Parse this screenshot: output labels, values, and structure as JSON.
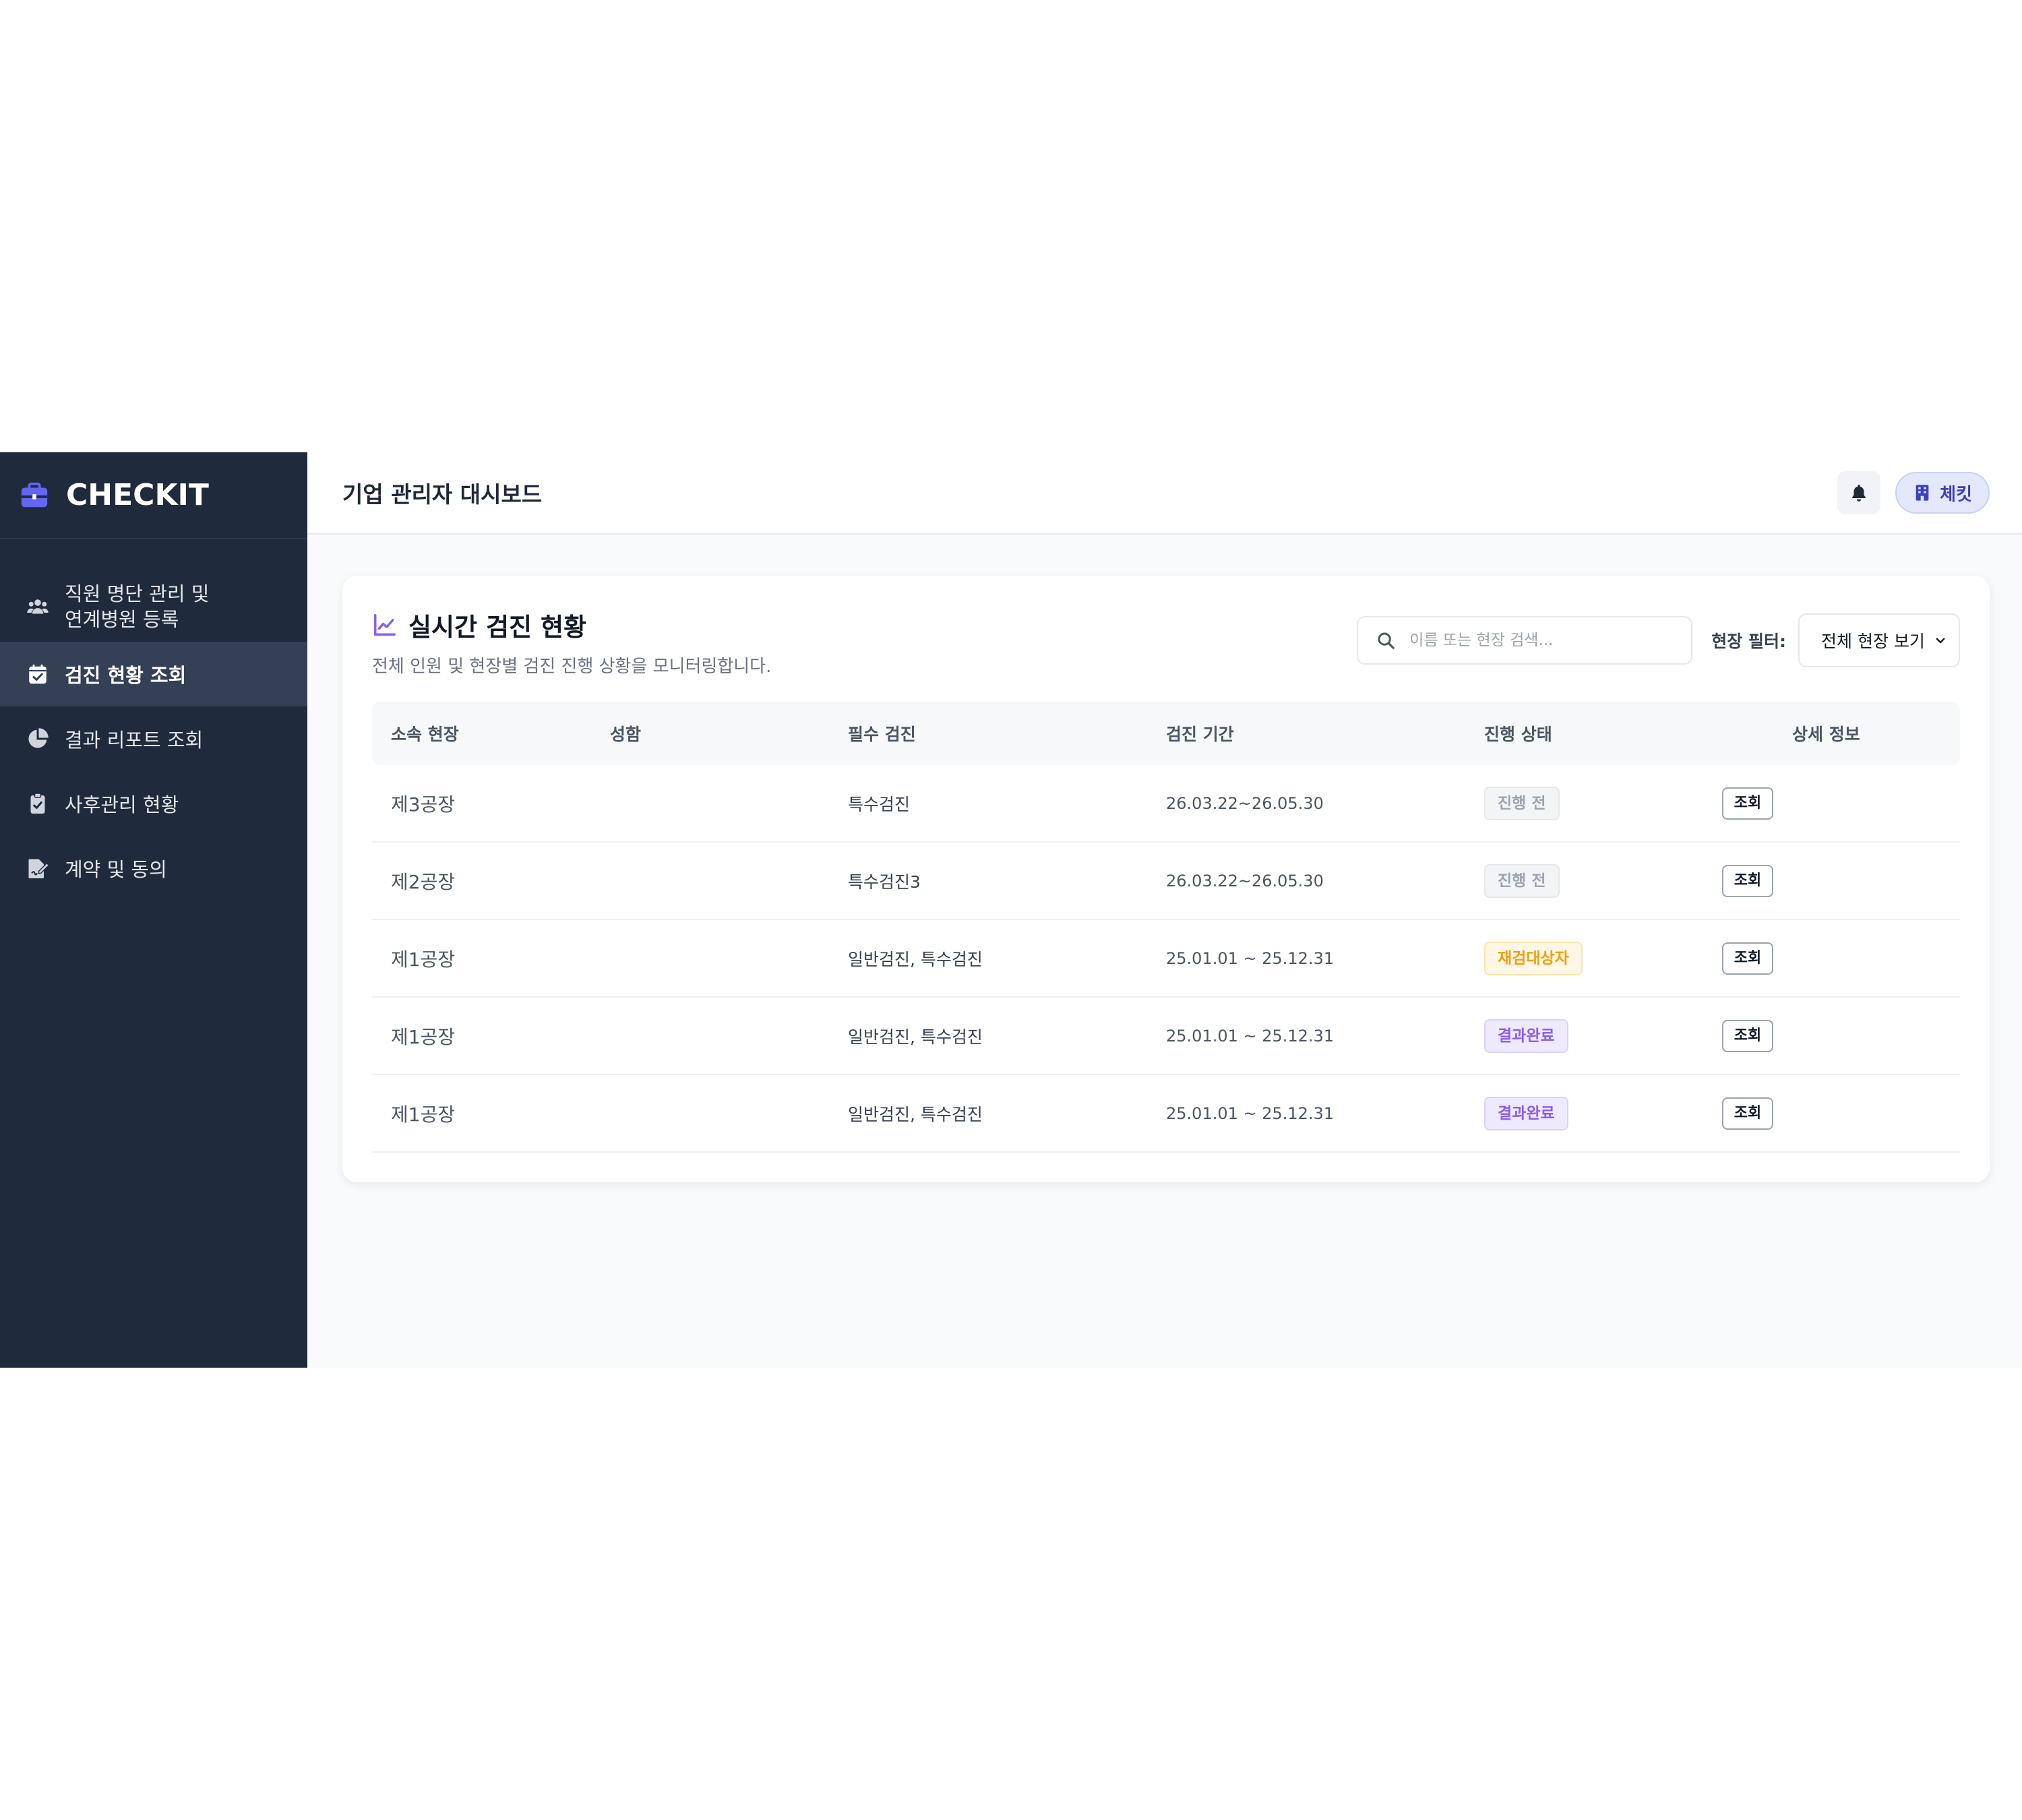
{
  "brand": {
    "name": "CHECKIT",
    "icon": "briefcase-icon"
  },
  "sidebar": {
    "items": [
      {
        "label_line1": "직원 명단 관리 및",
        "label_line2": "연계병원 등록",
        "icon": "users-icon",
        "active": false
      },
      {
        "label": "검진 현황 조회",
        "icon": "calendar-check-icon",
        "active": true
      },
      {
        "label": "결과 리포트 조회",
        "icon": "pie-chart-icon",
        "active": false
      },
      {
        "label": "사후관리 현황",
        "icon": "clipboard-check-icon",
        "active": false
      },
      {
        "label": "계약 및 동의",
        "icon": "file-signature-icon",
        "active": false
      }
    ]
  },
  "header": {
    "title": "기업 관리자 대시보드",
    "notification_icon": "bell-icon",
    "company_badge": {
      "label": "체킷",
      "icon": "building-icon"
    }
  },
  "card": {
    "title": "실시간 검진 현황",
    "title_icon": "chart-line-icon",
    "subtitle": "전체 인원 및 현장별 검진 진행 상황을 모니터링합니다.",
    "search": {
      "placeholder": "이름 또는 현장 검색...",
      "value": ""
    },
    "filter": {
      "label": "현장 필터:",
      "selected": "전체 현장 보기"
    }
  },
  "table": {
    "headers": [
      "소속 현장",
      "성함",
      "필수 검진",
      "검진 기간",
      "진행 상태",
      "상세 정보"
    ],
    "rows": [
      {
        "site": "제3공장",
        "name": "",
        "exam": "특수검진",
        "period": "26.03.22~26.05.30",
        "status": "진행 전",
        "status_type": "pending",
        "action": "조회"
      },
      {
        "site": "제2공장",
        "name": "",
        "exam": "특수검진3",
        "period": "26.03.22~26.05.30",
        "status": "진행 전",
        "status_type": "pending",
        "action": "조회"
      },
      {
        "site": "제1공장",
        "name": "",
        "exam": "일반검진, 특수검진",
        "period": "25.01.01 ~ 25.12.31",
        "status": "재검대상자",
        "status_type": "recheck",
        "action": "조회"
      },
      {
        "site": "제1공장",
        "name": "",
        "exam": "일반검진, 특수검진",
        "period": "25.01.01 ~ 25.12.31",
        "status": "결과완료",
        "status_type": "done",
        "action": "조회"
      },
      {
        "site": "제1공장",
        "name": "",
        "exam": "일반검진, 특수검진",
        "period": "25.01.01 ~ 25.12.31",
        "status": "결과완료",
        "status_type": "done",
        "action": "조회"
      }
    ]
  },
  "colors": {
    "sidebar_bg": "#1f2a3d",
    "sidebar_active": "#334056",
    "brand_icon": "#6366f1",
    "accent_purple": "#8b5cf6",
    "badge_company_bg": "#e3e8fd",
    "status_recheck": "#f59e0b"
  }
}
